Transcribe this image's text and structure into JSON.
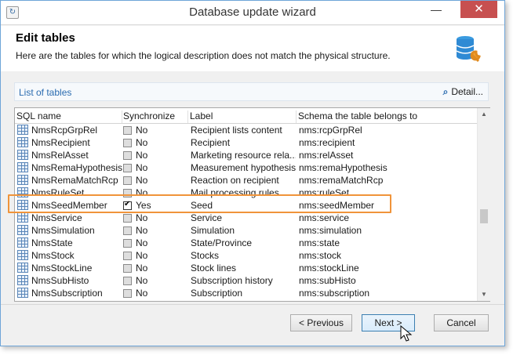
{
  "window": {
    "title": "Database update wizard"
  },
  "header": {
    "title": "Edit tables",
    "description": "Here are the tables for which the logical description does not match the physical structure."
  },
  "section": {
    "label": "List of tables",
    "detail_label": "Detail..."
  },
  "columns": {
    "sql_name": "SQL name",
    "synchronize": "Synchronize",
    "label": "Label",
    "schema": "Schema the table belongs to"
  },
  "rows": [
    {
      "name": "NmsRcpGrpRel",
      "sync": "No",
      "checked": false,
      "label": "Recipient lists content",
      "schema": "nms:rcpGrpRel"
    },
    {
      "name": "NmsRecipient",
      "sync": "No",
      "checked": false,
      "label": "Recipient",
      "schema": "nms:recipient"
    },
    {
      "name": "NmsRelAsset",
      "sync": "No",
      "checked": false,
      "label": "Marketing resource rela...",
      "schema": "nms:relAsset"
    },
    {
      "name": "NmsRemaHypothesis",
      "sync": "No",
      "checked": false,
      "label": "Measurement hypothesis",
      "schema": "nms:remaHypothesis"
    },
    {
      "name": "NmsRemaMatchRcp",
      "sync": "No",
      "checked": false,
      "label": "Reaction on recipient",
      "schema": "nms:remaMatchRcp"
    },
    {
      "name": "NmsRuleSet",
      "sync": "No",
      "checked": false,
      "label": "Mail processing rules",
      "schema": "nms:ruleSet"
    },
    {
      "name": "NmsSeedMember",
      "sync": "Yes",
      "checked": true,
      "label": "Seed",
      "schema": "nms:seedMember"
    },
    {
      "name": "NmsService",
      "sync": "No",
      "checked": false,
      "label": "Service",
      "schema": "nms:service"
    },
    {
      "name": "NmsSimulation",
      "sync": "No",
      "checked": false,
      "label": "Simulation",
      "schema": "nms:simulation"
    },
    {
      "name": "NmsState",
      "sync": "No",
      "checked": false,
      "label": "State/Province",
      "schema": "nms:state"
    },
    {
      "name": "NmsStock",
      "sync": "No",
      "checked": false,
      "label": "Stocks",
      "schema": "nms:stock"
    },
    {
      "name": "NmsStockLine",
      "sync": "No",
      "checked": false,
      "label": "Stock lines",
      "schema": "nms:stockLine"
    },
    {
      "name": "NmsSubHisto",
      "sync": "No",
      "checked": false,
      "label": "Subscription history",
      "schema": "nms:subHisto"
    },
    {
      "name": "NmsSubscription",
      "sync": "No",
      "checked": false,
      "label": "Subscription",
      "schema": "nms:subscription"
    }
  ],
  "buttons": {
    "previous": "< Previous",
    "next": "Next >",
    "cancel": "Cancel"
  },
  "colors": {
    "highlight": "#f0943a",
    "link": "#2b6cb0",
    "close": "#c75050"
  },
  "icons": {
    "app": "wizard-app-icon",
    "database": "database-wrench-icon",
    "search": "search-icon",
    "table": "table-icon"
  }
}
